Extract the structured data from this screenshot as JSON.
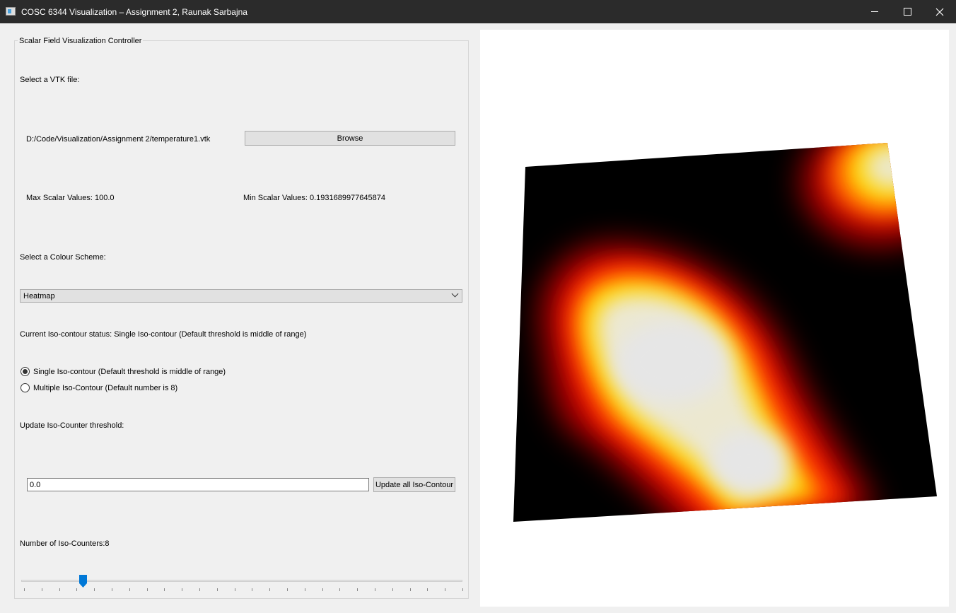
{
  "window": {
    "title": "COSC 6344 Visualization – Assignment 2, Raunak Sarbajna",
    "app_icon": "app-window-icon",
    "controls": [
      "minimize-icon",
      "maximize-icon",
      "close-icon"
    ]
  },
  "controller": {
    "group_title": "Scalar Field Visualization Controller",
    "select_file_label": "Select a VTK file:",
    "file_path": "D:/Code/Visualization/Assignment 2/temperature1.vtk",
    "browse_label": "Browse",
    "max_scalar": "Max Scalar Values: 100.0",
    "min_scalar": "Min Scalar Values: 0.1931689977645874",
    "colour_scheme_label": "Select a Colour Scheme:",
    "colour_scheme_value": "Heatmap",
    "iso_status": "Current Iso-contour status: Single Iso-contour (Default threshold is middle of range)",
    "radio_single": "Single Iso-contour (Default threshold is middle of range)",
    "radio_multiple": "Multiple Iso-Contour (Default number is 8)",
    "radio_selected": "single",
    "threshold_label": "Update Iso-Counter threshold:",
    "threshold_value": "0.0",
    "update_label": "Update all Iso-Contour",
    "num_counters_label": "Number of Iso-Counters:8",
    "slider_value": 8,
    "slider_fraction": 0.14
  },
  "colors": {
    "titlebar_bg": "#2b2b2b",
    "window_bg": "#f0f0f0",
    "slider_handle": "#0078d7",
    "heatmap": [
      "#000000",
      "#c00000",
      "#ff3300",
      "#ffd700",
      "#f0f0c8",
      "#e8e8e8"
    ]
  }
}
